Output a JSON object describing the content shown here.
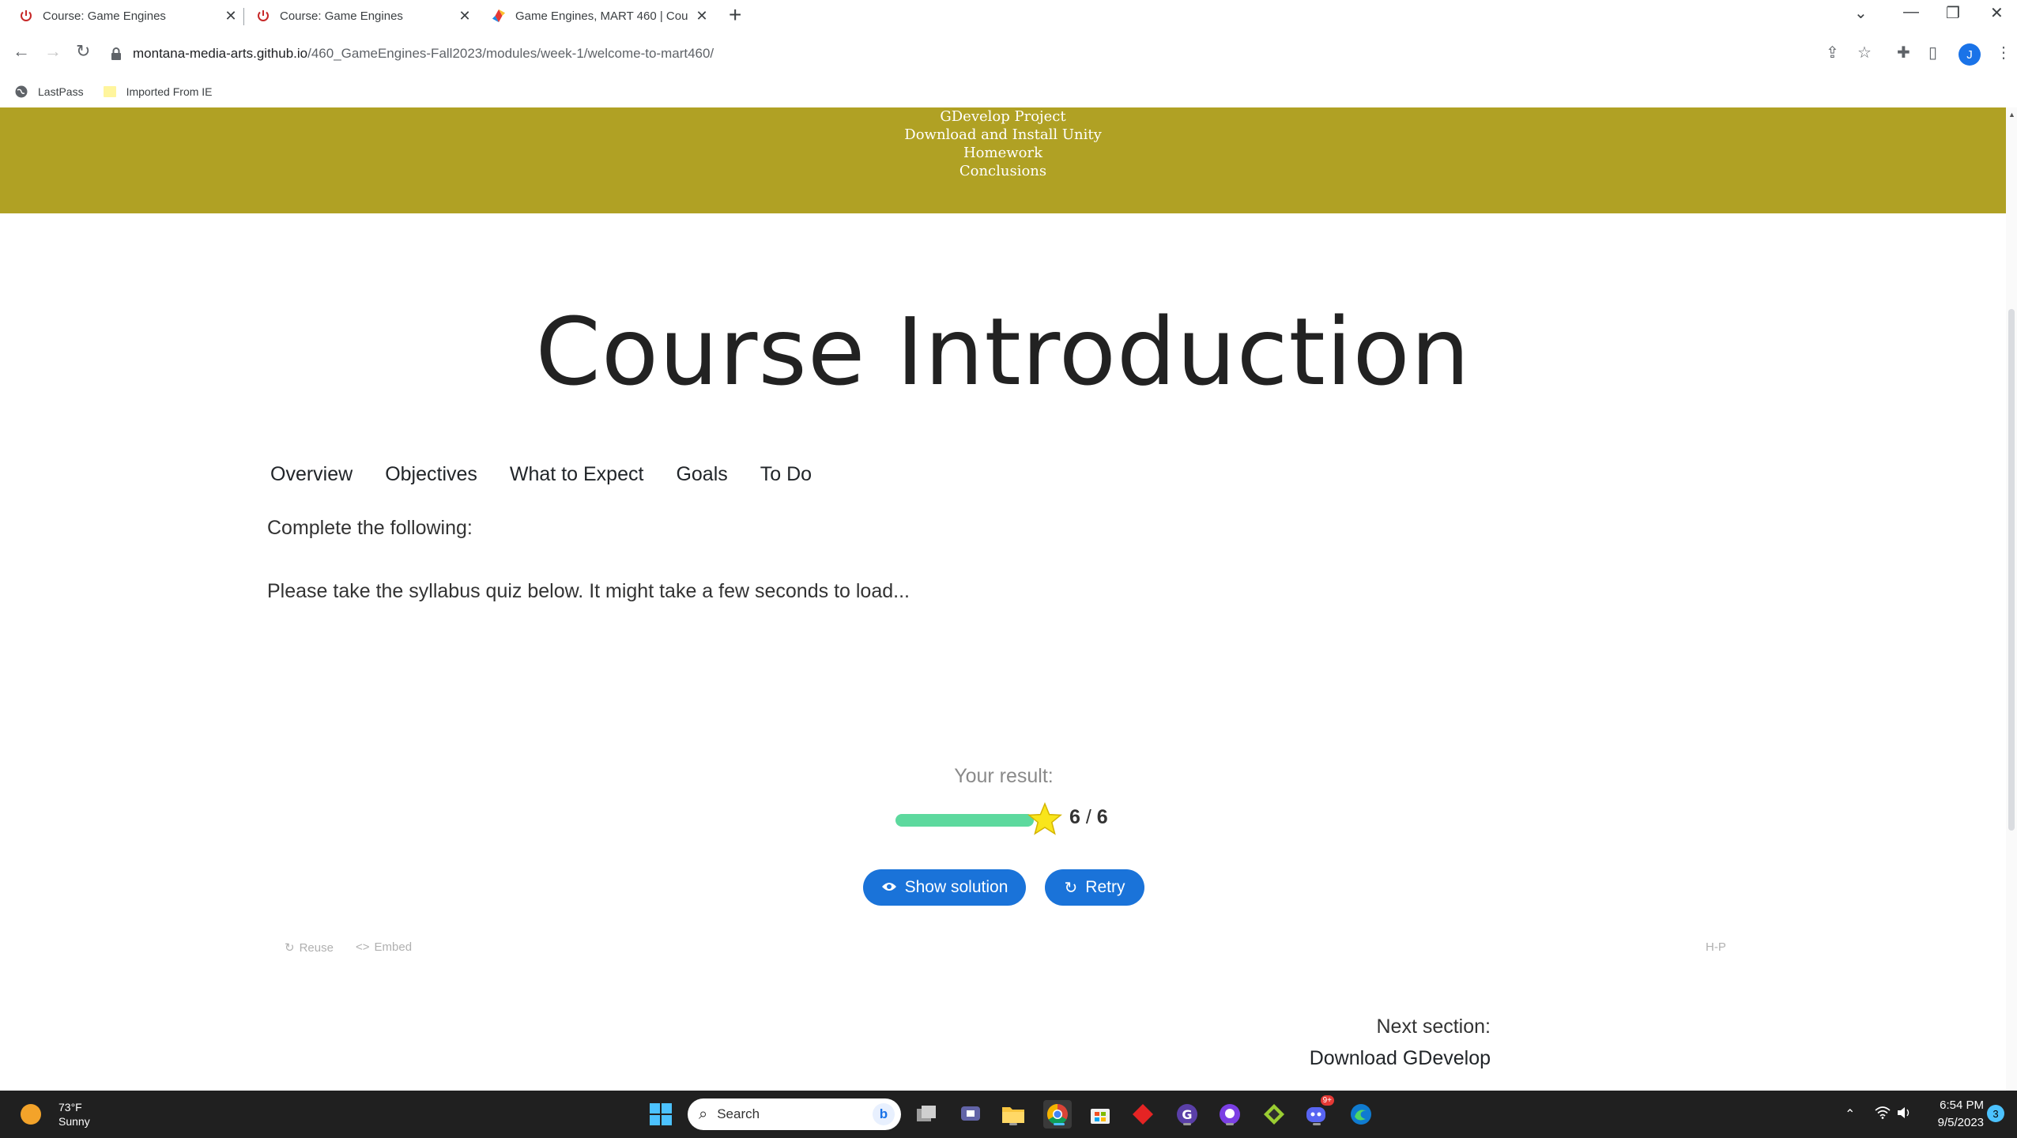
{
  "browser": {
    "tabs": [
      {
        "label": "Course: Game Engines"
      },
      {
        "label": "Course: Game Engines"
      },
      {
        "label": "Game Engines, MART 460 | Cou"
      }
    ],
    "url_host": "montana-media-arts.github.io",
    "url_path": "/460_GameEngines-Fall2023/modules/week-1/welcome-to-mart460/",
    "profile_initial": "J",
    "bookmarks": [
      {
        "label": "LastPass"
      },
      {
        "label": "Imported From IE"
      }
    ]
  },
  "page": {
    "toc_items": [
      "GDevelop Project",
      "Download and Install Unity",
      "Homework",
      "Conclusions"
    ],
    "title": "Course Introduction",
    "nav_tabs": [
      "Overview",
      "Objectives",
      "What to Expect",
      "Goals",
      "To Do"
    ],
    "instruction": "Complete the following:",
    "quiz_note": "Please take the syllabus quiz below. It might take a few seconds to load...",
    "quiz": {
      "result_label": "Your result:",
      "score": "6",
      "max_score": "6",
      "score_fraction": 1.0,
      "show_solution_label": "Show solution",
      "retry_label": "Retry",
      "reuse_label": "Reuse",
      "embed_label": "Embed",
      "h5p_label": "H-P"
    },
    "next_section_label": "Next section:",
    "next_section_link": "Download GDevelop"
  },
  "taskbar": {
    "temperature": "73°F",
    "condition": "Sunny",
    "search_placeholder": "Search",
    "time": "6:54 PM",
    "date": "9/5/2023",
    "notification_count": "3",
    "discord_badge": "9+"
  },
  "colors": {
    "toc_bg": "#b0a124",
    "button_blue": "#1a73d9",
    "score_bar": "#5dd99e",
    "taskbar_bg": "#202020"
  }
}
